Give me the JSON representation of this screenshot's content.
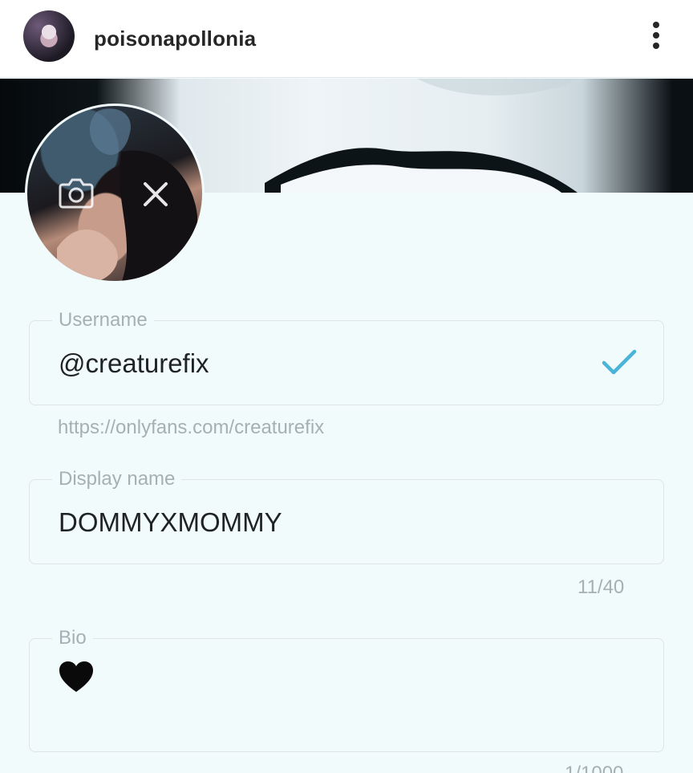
{
  "header": {
    "username": "poisonapollonia"
  },
  "username_field": {
    "label": "Username",
    "value": "@creaturefix",
    "url_hint": "https://onlyfans.com/creaturefix"
  },
  "display_name_field": {
    "label": "Display name",
    "value": "DOMMYXMOMMY",
    "counter": "11/40"
  },
  "bio_field": {
    "label": "Bio",
    "value_icon": "black-heart-emoji",
    "counter": "1/1000"
  },
  "colors": {
    "accent_check": "#4ab3d8",
    "header_bg": "#ffffff",
    "page_bg": "#f2fbfc"
  }
}
